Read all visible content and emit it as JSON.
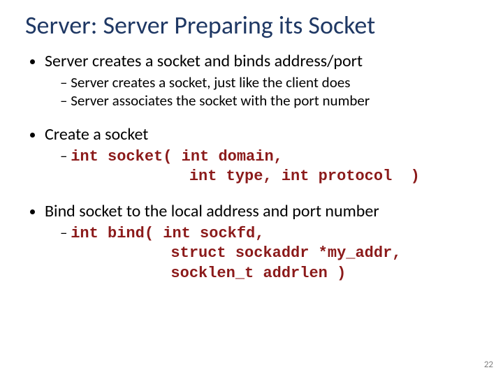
{
  "title": "Server: Server Preparing its Socket",
  "bullets": [
    {
      "text": "Server creates a socket and binds address/port",
      "sub": [
        {
          "text": "Server creates a socket, just like the client does",
          "code": false
        },
        {
          "text": "Server associates the socket with the port number",
          "code": false
        }
      ]
    },
    {
      "text": "Create a socket",
      "sub": [
        {
          "text": "int socket( int domain,\n              int type, int protocol  )",
          "code": true
        }
      ]
    },
    {
      "text": "Bind socket to the local address and port number",
      "sub": [
        {
          "text": "int bind( int sockfd,\n            struct sockaddr *my_addr,\n            socklen_t addrlen )",
          "code": true
        }
      ]
    }
  ],
  "page_number": "22"
}
